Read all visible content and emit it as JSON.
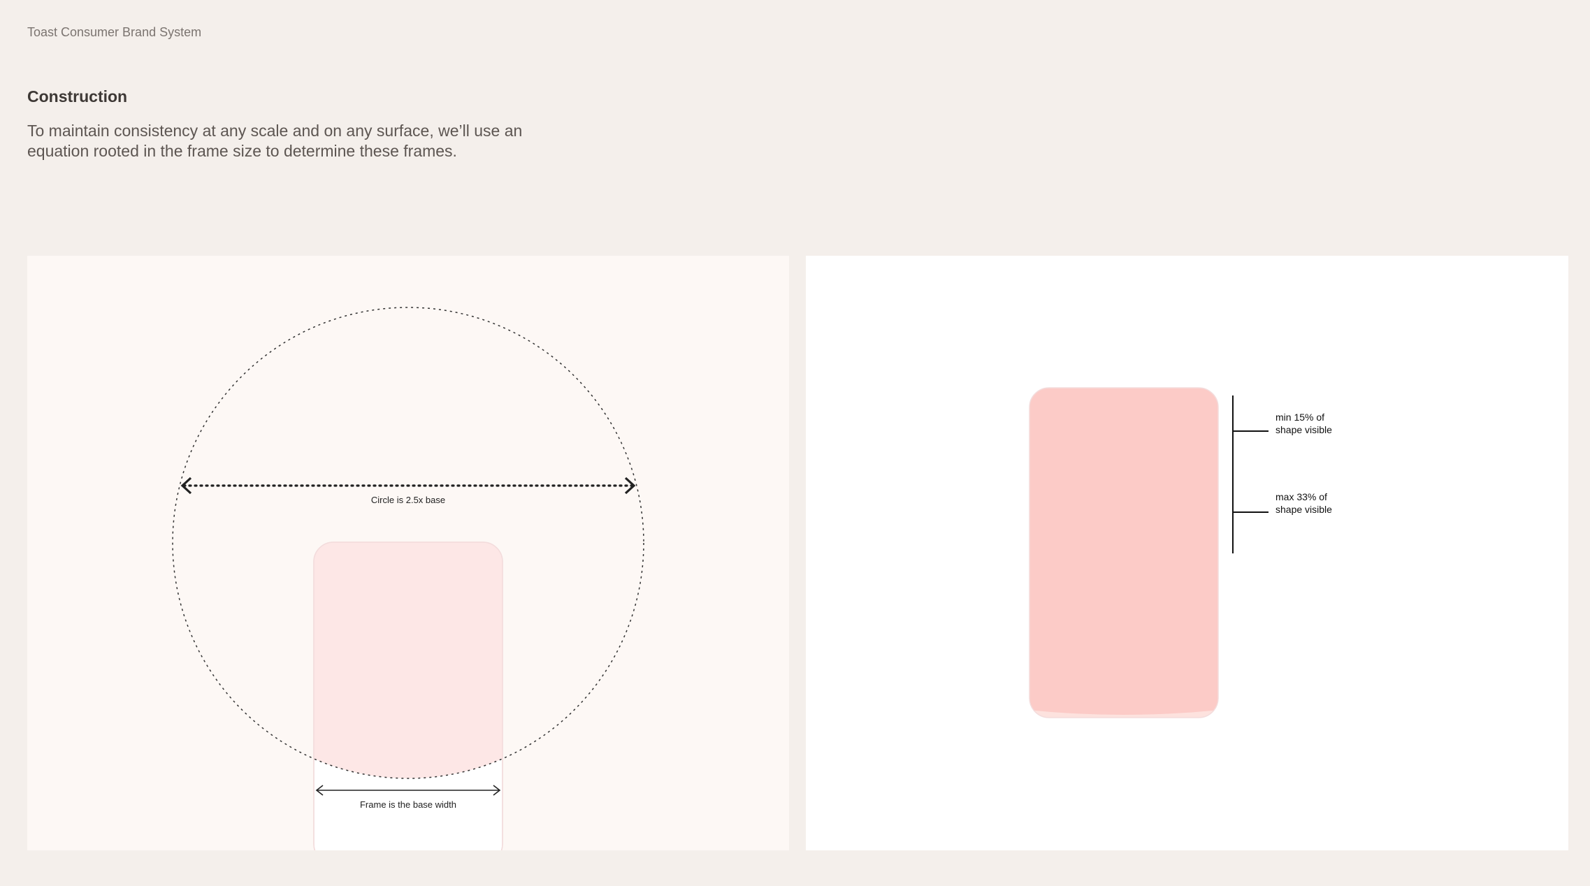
{
  "header": {
    "brand": "Toast Consumer Brand System",
    "title": "Construction",
    "description": "To maintain consistency at any scale and on any surface, we’ll use an equation rooted in the frame size to determine these frames."
  },
  "left_panel": {
    "circle_label": "Circle is 2.5x base",
    "frame_label": "Frame is the base width"
  },
  "right_panel": {
    "min_label_line1": "min 15% of",
    "min_label_line2": "shape visible",
    "max_label_line1": "max 33% of",
    "max_label_line2": "shape visible"
  },
  "colors": {
    "page_background": "#f4efeb",
    "left_panel_background": "#fdf8f5",
    "right_panel_background": "#ffffff",
    "shape_light_pink": "#fde7e6",
    "shape_mid_pink": "#fde2de",
    "shape_strong_pink": "#fccbc7",
    "frame_fill": "#fdf8f5"
  }
}
